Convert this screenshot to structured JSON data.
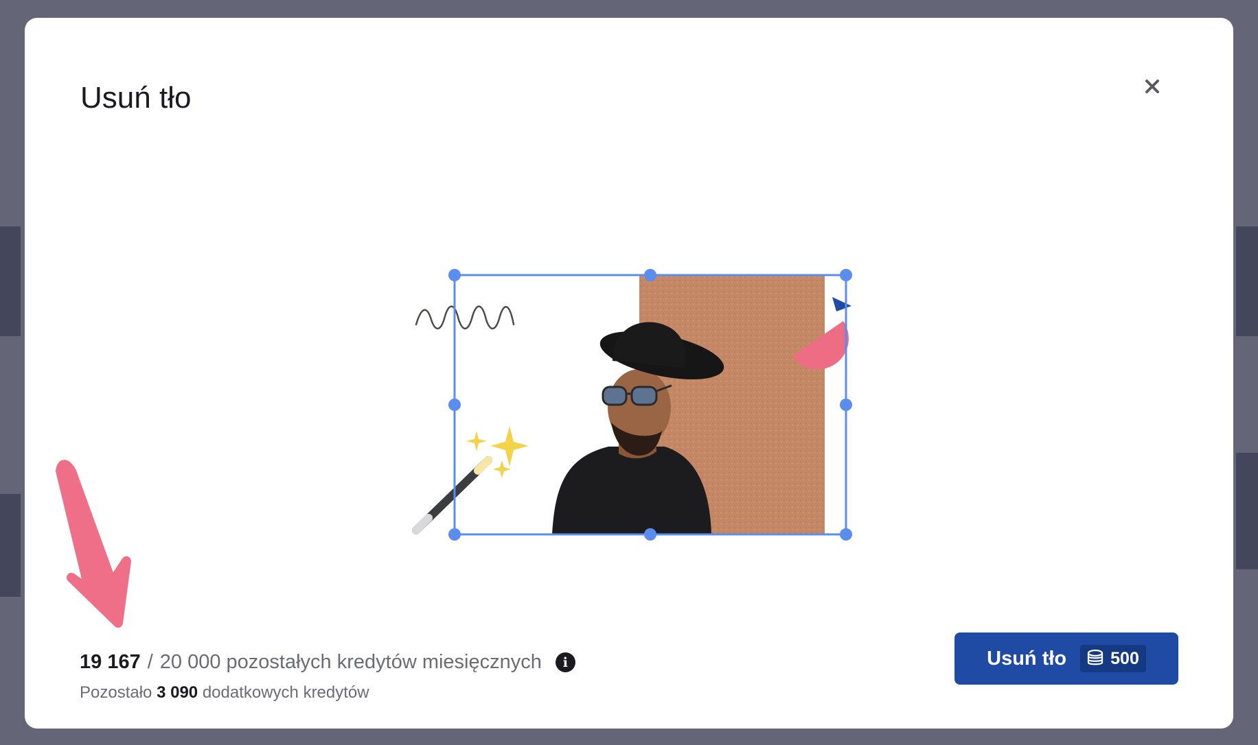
{
  "modal": {
    "title": "Usuń tło",
    "close_label": "×"
  },
  "credits": {
    "used": "19 167",
    "separator": "/",
    "total_text": "20 000 pozostałych kredytów miesięcznych",
    "info_label": "i"
  },
  "extra": {
    "prefix": "Pozostało",
    "amount": "3 090",
    "suffix": "dodatkowych kredytów"
  },
  "action": {
    "label": "Usuń tło",
    "cost": "500",
    "cost_icon": "coin-stack-icon"
  },
  "colors": {
    "accent": "#1f4ba5",
    "selection": "#5b8def",
    "arrow": "#ee6f87"
  }
}
